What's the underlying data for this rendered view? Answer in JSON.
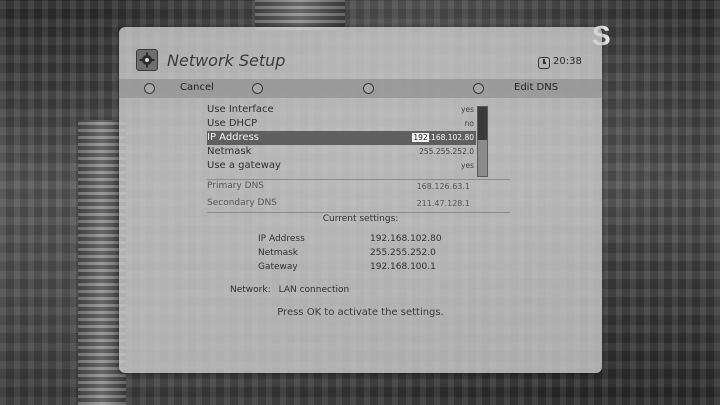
{
  "brand": "S",
  "header": {
    "title": "Network Setup",
    "icon": "gear-icon",
    "clock_icon": "clock-icon",
    "time": "20:38"
  },
  "actions": {
    "cancel_label": "Cancel",
    "edit_dns_label": "Edit DNS"
  },
  "settings": [
    {
      "label": "Use Interface",
      "value": "yes"
    },
    {
      "label": "Use DHCP",
      "value": "no"
    },
    {
      "label": "IP Address",
      "value_cursor": "192",
      "value_rest": ".168.102.80"
    },
    {
      "label": "Netmask",
      "value": "255.255.252.0"
    },
    {
      "label": "Use a gateway",
      "value": "yes"
    }
  ],
  "dns": [
    {
      "label": "Primary DNS",
      "value": "168.126.63.1"
    },
    {
      "label": "Secondary DNS",
      "value": "211.47.128.1"
    }
  ],
  "current": {
    "heading": "Current settings:",
    "rows": [
      {
        "label": "IP Address",
        "value": "192.168.102.80"
      },
      {
        "label": "Netmask",
        "value": "255.255.252.0"
      },
      {
        "label": "Gateway",
        "value": "192.168.100.1"
      }
    ]
  },
  "network": {
    "label": "Network:",
    "value": "LAN connection"
  },
  "hint": "Press OK to activate the settings."
}
